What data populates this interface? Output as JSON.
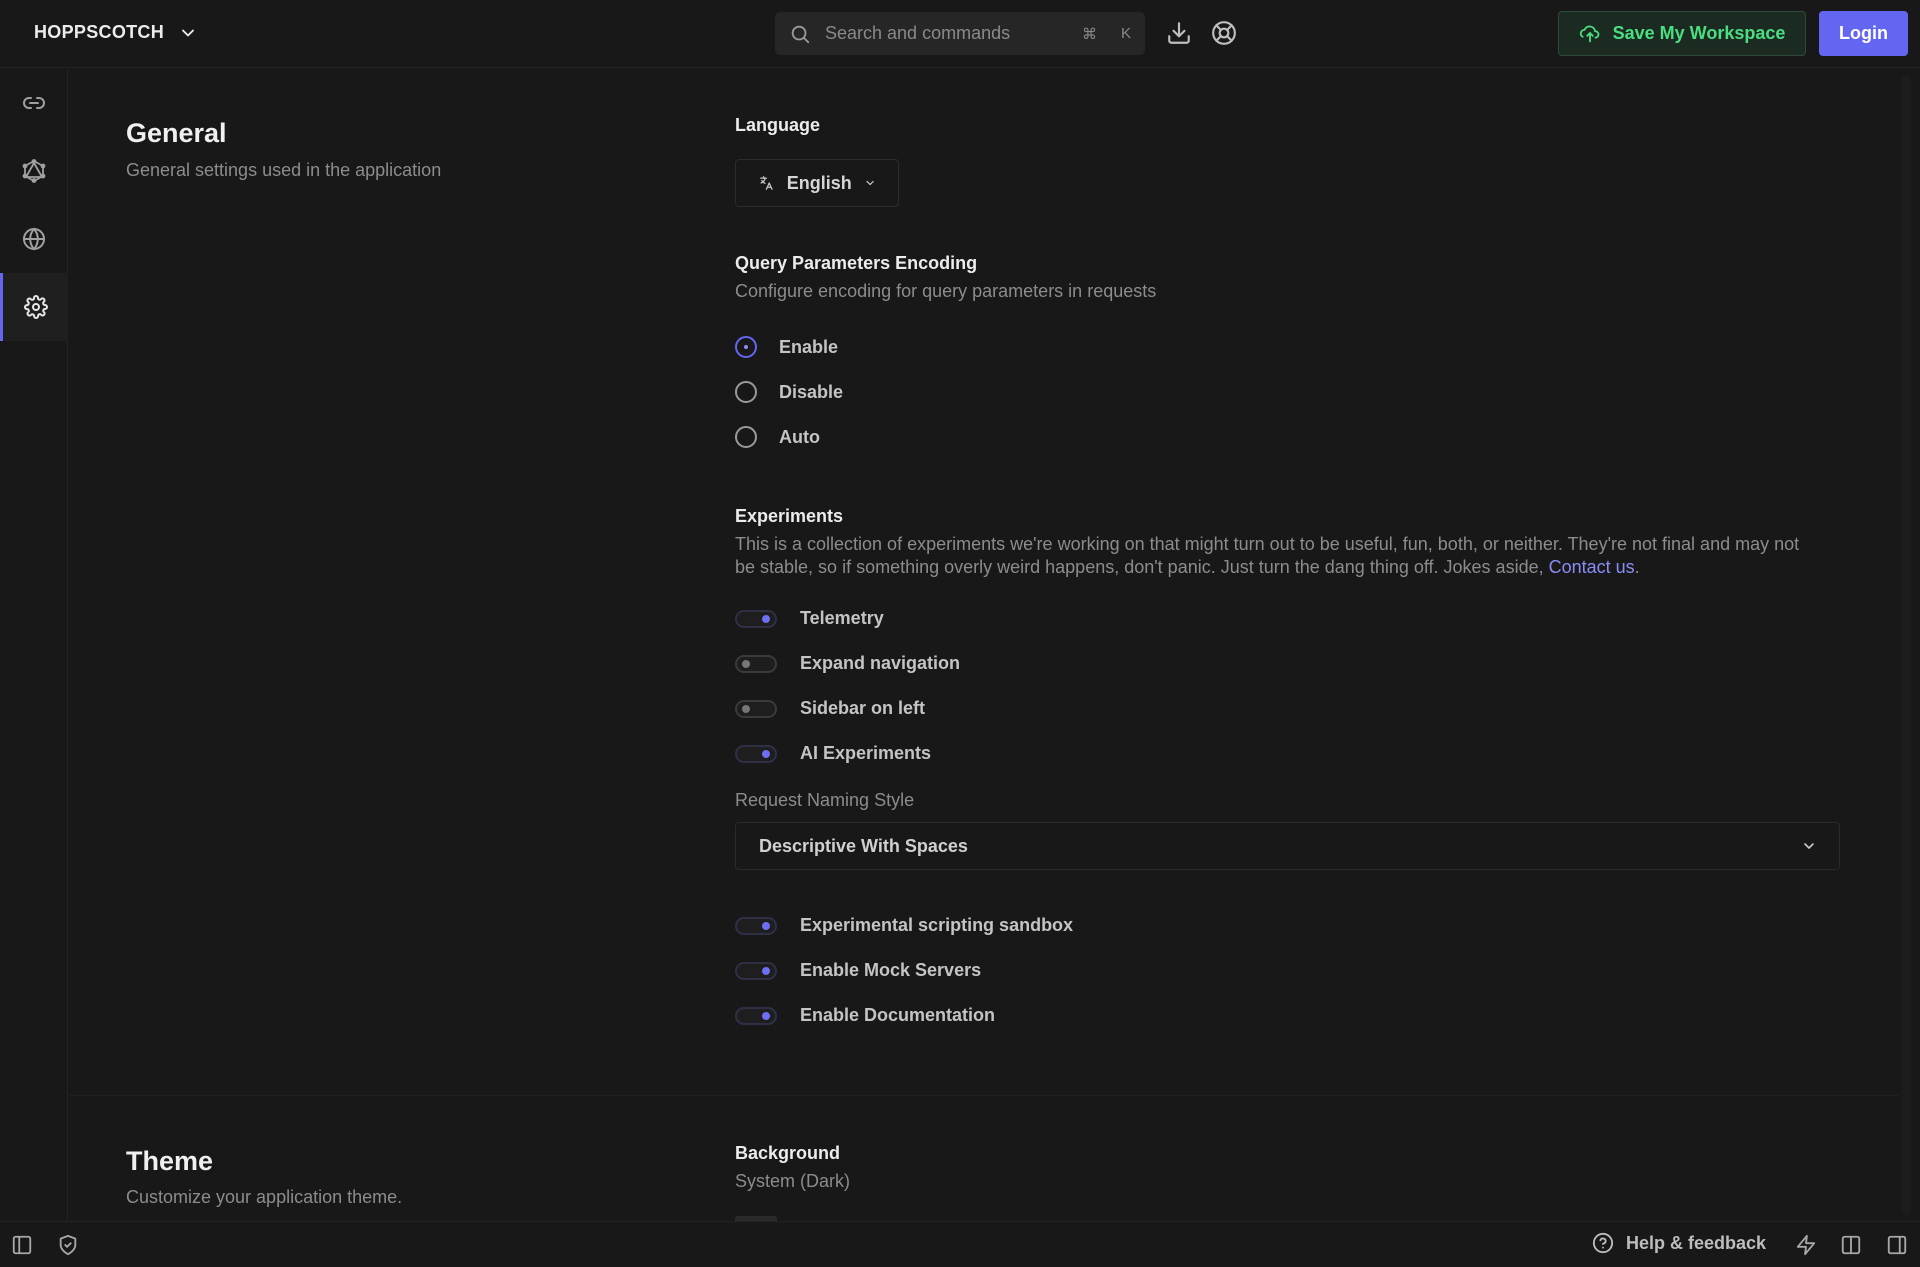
{
  "header": {
    "brand": "HOPPSCOTCH",
    "search_placeholder": "Search and commands",
    "shortcut_cmd": "⌘",
    "shortcut_key": "K",
    "save_label": "Save My Workspace",
    "login_label": "Login"
  },
  "sidebar": {
    "items": [
      {
        "icon": "link-icon"
      },
      {
        "icon": "graphql-icon"
      },
      {
        "icon": "globe-icon"
      },
      {
        "icon": "gear-icon",
        "active": true
      }
    ]
  },
  "general": {
    "title": "General",
    "description": "General settings used in the application",
    "language": {
      "label": "Language",
      "value": "English"
    },
    "query_encoding": {
      "label": "Query Parameters Encoding",
      "description": "Configure encoding for query parameters in requests",
      "options": [
        {
          "label": "Enable",
          "selected": true
        },
        {
          "label": "Disable",
          "selected": false
        },
        {
          "label": "Auto",
          "selected": false
        }
      ]
    },
    "experiments": {
      "label": "Experiments",
      "description_line1": "This is a collection of experiments we're working on that might turn out to be useful, fun, both, or neither. They're not final and may not",
      "description_line2": "be stable, so if something overly weird happens, don't panic. Just turn the dang thing off. Jokes aside, ",
      "contact_link": "Contact us",
      "period": ".",
      "toggles": [
        {
          "label": "Telemetry",
          "on": true
        },
        {
          "label": "Expand navigation",
          "on": false
        },
        {
          "label": "Sidebar on left",
          "on": false
        },
        {
          "label": "AI Experiments",
          "on": true
        }
      ],
      "naming_style_label": "Request Naming Style",
      "naming_style_value": "Descriptive With Spaces",
      "toggles2": [
        {
          "label": "Experimental scripting sandbox",
          "on": true
        },
        {
          "label": "Enable Mock Servers",
          "on": true
        },
        {
          "label": "Enable Documentation",
          "on": true
        }
      ]
    }
  },
  "theme": {
    "title": "Theme",
    "description": "Customize your application theme.",
    "background_label": "Background",
    "background_value": "System (Dark)"
  },
  "footer": {
    "help_label": "Help & feedback"
  },
  "colors": {
    "accent": "#6366f1",
    "save_green": "#4ade80",
    "background": "#181818"
  }
}
